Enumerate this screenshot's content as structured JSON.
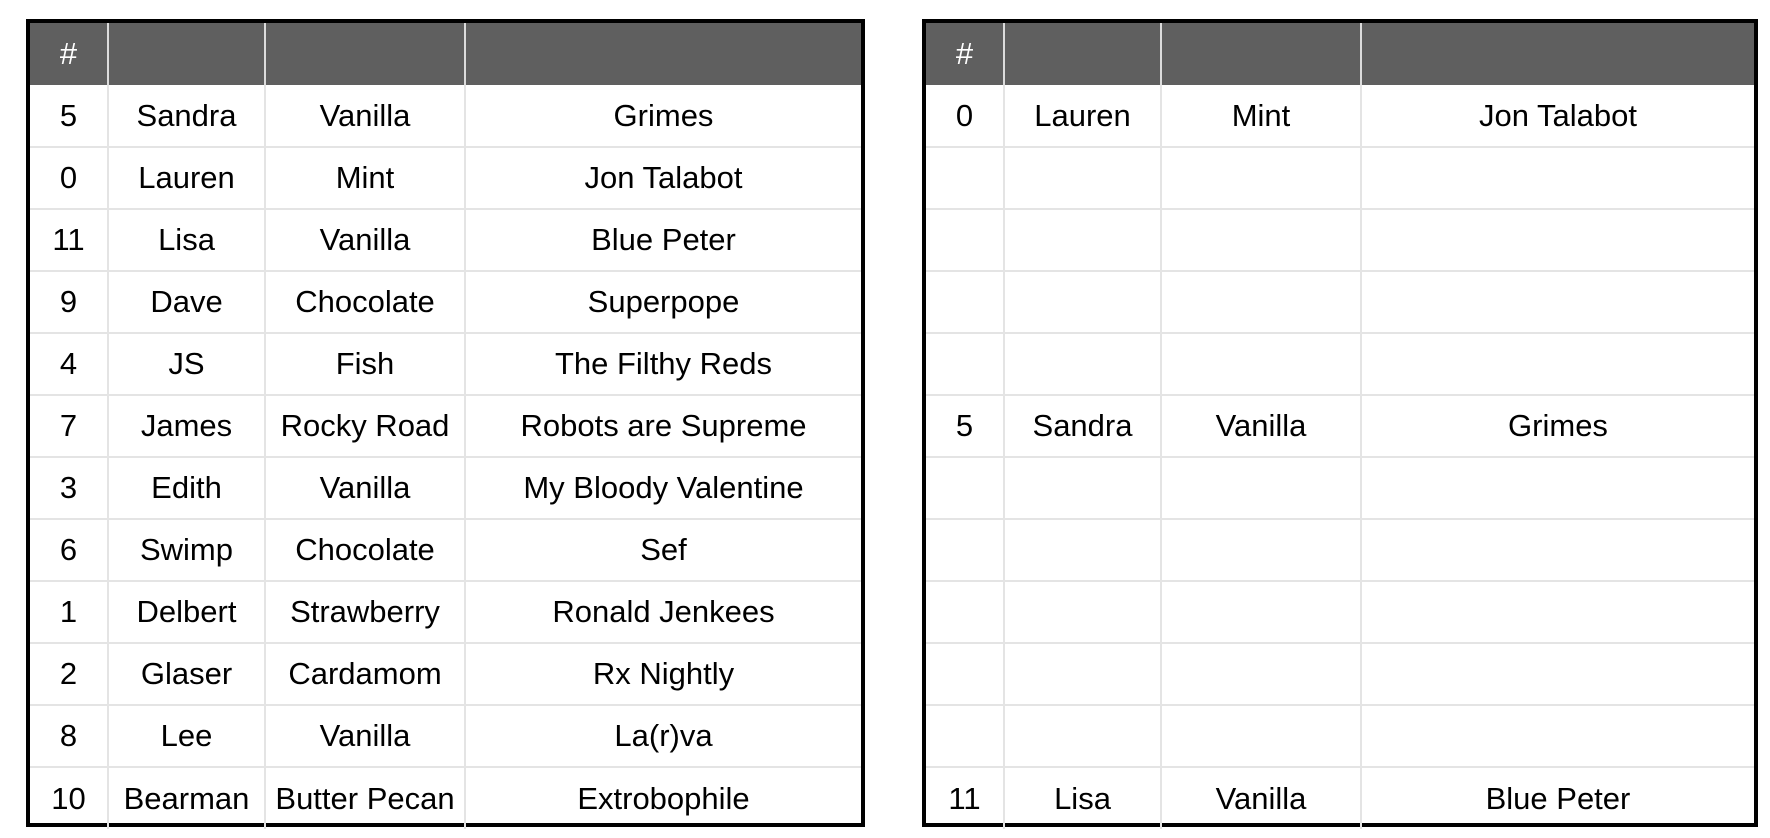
{
  "colors": {
    "header_bg": "#5f5f5f",
    "header_text": "#ffffff",
    "frame": "#000000",
    "grid": "#e4e4e4"
  },
  "left_table": {
    "columns": [
      "#",
      "",
      "",
      ""
    ],
    "rows": [
      [
        "5",
        "Sandra",
        "Vanilla",
        "Grimes"
      ],
      [
        "0",
        "Lauren",
        "Mint",
        "Jon Talabot"
      ],
      [
        "11",
        "Lisa",
        "Vanilla",
        "Blue Peter"
      ],
      [
        "9",
        "Dave",
        "Chocolate",
        "Superpope"
      ],
      [
        "4",
        "JS",
        "Fish",
        "The Filthy Reds"
      ],
      [
        "7",
        "James",
        "Rocky Road",
        "Robots are Supreme"
      ],
      [
        "3",
        "Edith",
        "Vanilla",
        "My Bloody Valentine"
      ],
      [
        "6",
        "Swimp",
        "Chocolate",
        "Sef"
      ],
      [
        "1",
        "Delbert",
        "Strawberry",
        "Ronald Jenkees"
      ],
      [
        "2",
        "Glaser",
        "Cardamom",
        "Rx Nightly"
      ],
      [
        "8",
        "Lee",
        "Vanilla",
        "La(r)va"
      ],
      [
        "10",
        "Bearman",
        "Butter Pecan",
        "Extrobophile"
      ]
    ]
  },
  "right_table": {
    "columns": [
      "#",
      "",
      "",
      ""
    ],
    "rows": [
      [
        "0",
        "Lauren",
        "Mint",
        "Jon Talabot"
      ],
      [
        "",
        "",
        "",
        ""
      ],
      [
        "",
        "",
        "",
        ""
      ],
      [
        "",
        "",
        "",
        ""
      ],
      [
        "",
        "",
        "",
        ""
      ],
      [
        "5",
        "Sandra",
        "Vanilla",
        "Grimes"
      ],
      [
        "",
        "",
        "",
        ""
      ],
      [
        "",
        "",
        "",
        ""
      ],
      [
        "",
        "",
        "",
        ""
      ],
      [
        "",
        "",
        "",
        ""
      ],
      [
        "",
        "",
        "",
        ""
      ],
      [
        "11",
        "Lisa",
        "Vanilla",
        "Blue Peter"
      ]
    ]
  }
}
